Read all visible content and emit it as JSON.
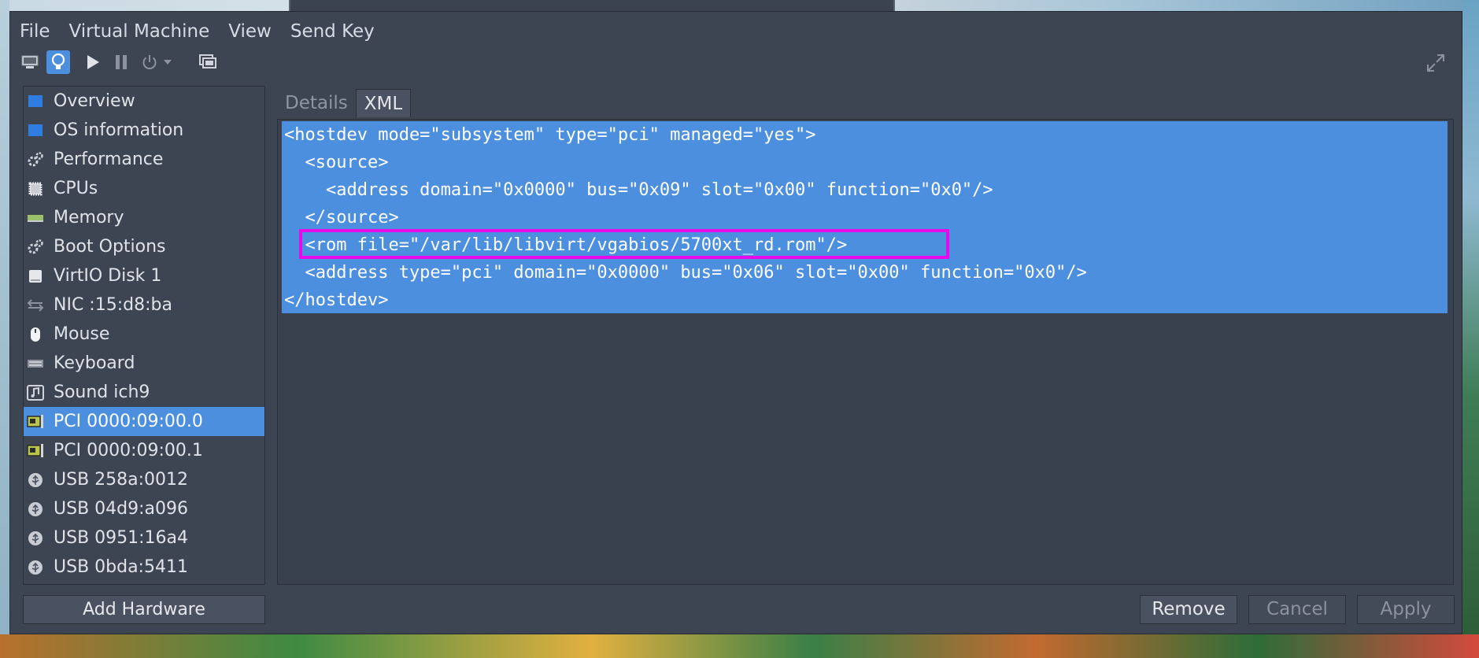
{
  "menu": [
    "File",
    "Virtual Machine",
    "View",
    "Send Key"
  ],
  "toolbar": {
    "buttons": [
      "monitor-icon",
      "lightbulb-icon",
      "play-icon",
      "pause-icon",
      "power-icon",
      "dropdown-arrow-icon",
      "screenshot-icon"
    ],
    "fullscreen": "fullscreen-icon"
  },
  "sidebar": {
    "items": [
      {
        "label": "Overview",
        "icon": "monitor-icon"
      },
      {
        "label": "OS information",
        "icon": "monitor-icon"
      },
      {
        "label": "Performance",
        "icon": "gears-icon"
      },
      {
        "label": "CPUs",
        "icon": "cpu-chip-icon"
      },
      {
        "label": "Memory",
        "icon": "memory-stick-icon"
      },
      {
        "label": "Boot Options",
        "icon": "gears-icon"
      },
      {
        "label": "VirtIO Disk 1",
        "icon": "disk-icon"
      },
      {
        "label": "NIC :15:d8:ba",
        "icon": "network-arrows-icon"
      },
      {
        "label": "Mouse",
        "icon": "mouse-icon"
      },
      {
        "label": "Keyboard",
        "icon": "keyboard-icon"
      },
      {
        "label": "Sound ich9",
        "icon": "sound-icon"
      },
      {
        "label": "PCI 0000:09:00.0",
        "icon": "pci-card-icon",
        "selected": true
      },
      {
        "label": "PCI 0000:09:00.1",
        "icon": "pci-card-icon"
      },
      {
        "label": "USB 258a:0012",
        "icon": "usb-icon"
      },
      {
        "label": "USB 04d9:a096",
        "icon": "usb-icon"
      },
      {
        "label": "USB 0951:16a4",
        "icon": "usb-icon"
      },
      {
        "label": "USB 0bda:5411",
        "icon": "usb-icon"
      }
    ],
    "add_hardware": "Add Hardware"
  },
  "tabs": [
    "Details",
    "XML"
  ],
  "active_tab": "XML",
  "xml": {
    "lines": [
      "<hostdev mode=\"subsystem\" type=\"pci\" managed=\"yes\">",
      "  <source>",
      "    <address domain=\"0x0000\" bus=\"0x09\" slot=\"0x00\" function=\"0x0\"/>",
      "  </source>",
      "  <rom file=\"/var/lib/libvirt/vgabios/5700xt_rd.rom\"/>",
      "  <address type=\"pci\" domain=\"0x0000\" bus=\"0x06\" slot=\"0x00\" function=\"0x0\"/>",
      "</hostdev>"
    ],
    "highlighted_line": 4
  },
  "buttons": {
    "remove": "Remove",
    "cancel": "Cancel",
    "apply": "Apply"
  },
  "colors": {
    "selection": "#4c8fdf",
    "highlight_box": "#e80ae8",
    "window_bg": "#3d4452"
  }
}
